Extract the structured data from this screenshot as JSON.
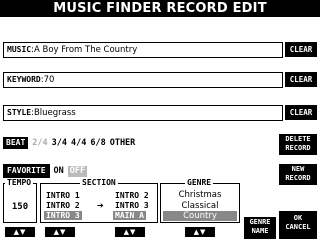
{
  "title": "MUSIC FINDER RECORD EDIT",
  "fields": {
    "music": {
      "key": "MUSIC",
      "value": "A Boy From The Country"
    },
    "keyword": {
      "key": "KEYWORD",
      "value": "70"
    },
    "style": {
      "key": "STYLE",
      "value": "Bluegrass"
    }
  },
  "buttons": {
    "clear": "CLEAR",
    "delete_record": [
      "DELETE",
      "RECORD"
    ],
    "new_record": [
      "NEW",
      "RECORD"
    ],
    "genre_name": [
      "GENRE",
      "NAME"
    ],
    "ok_cancel": [
      "OK",
      "CANCEL"
    ]
  },
  "beat": {
    "label": "BEAT",
    "options": [
      "2/4",
      "3/4",
      "4/4",
      "6/8",
      "OTHER"
    ],
    "selected": "2/4"
  },
  "favorite": {
    "label": "FAVORITE",
    "on": "ON",
    "off": "OFF"
  },
  "tempo": {
    "title": "TEMPO",
    "value": "150"
  },
  "section": {
    "title": "SECTION",
    "left": [
      "INTRO 1",
      "INTRO 2",
      "INTRO 3"
    ],
    "right": [
      "INTRO 2",
      "INTRO 3",
      "MAIN A"
    ],
    "selected_left": "INTRO 3",
    "selected_right": "MAIN A"
  },
  "genre": {
    "title": "GENRE",
    "items": [
      "Christmas",
      "Classical",
      "Country"
    ],
    "selected": "Country"
  },
  "arrow_label": "▲▼"
}
